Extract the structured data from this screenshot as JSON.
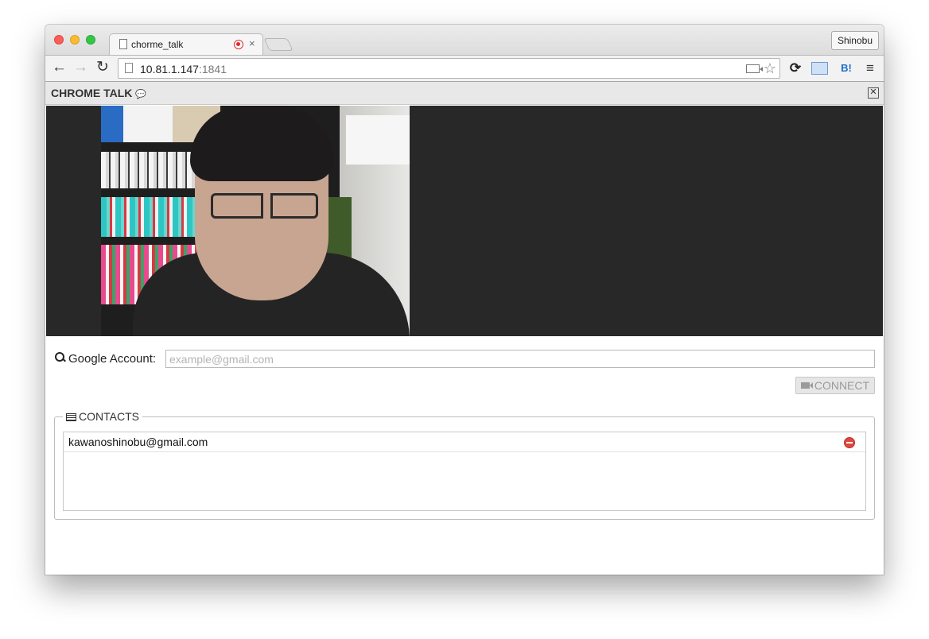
{
  "browser": {
    "tab_title": "chorme_talk",
    "tab_close_glyph": "×",
    "profile_name": "Shinobu",
    "url_host": "10.81.1.147",
    "url_port": ":1841",
    "extensions": {
      "hatena_label": "B!"
    }
  },
  "app": {
    "title": "CHROME TALK",
    "close_glyph": "✕"
  },
  "form": {
    "account_label": "Google Account:",
    "account_placeholder": "example@gmail.com",
    "account_value": "",
    "connect_label": "CONNECT"
  },
  "contacts": {
    "legend": "CONTACTS",
    "items": [
      {
        "email": "kawanoshinobu@gmail.com"
      }
    ]
  },
  "icons": {
    "search": "search-icon",
    "chat": "comments-icon",
    "camera": "video-camera-icon",
    "list": "list-icon",
    "remove": "minus-circle-icon"
  },
  "colors": {
    "video_background": "#282828",
    "remove_icon": "#e0483f",
    "record_indicator": "#e4262c"
  }
}
